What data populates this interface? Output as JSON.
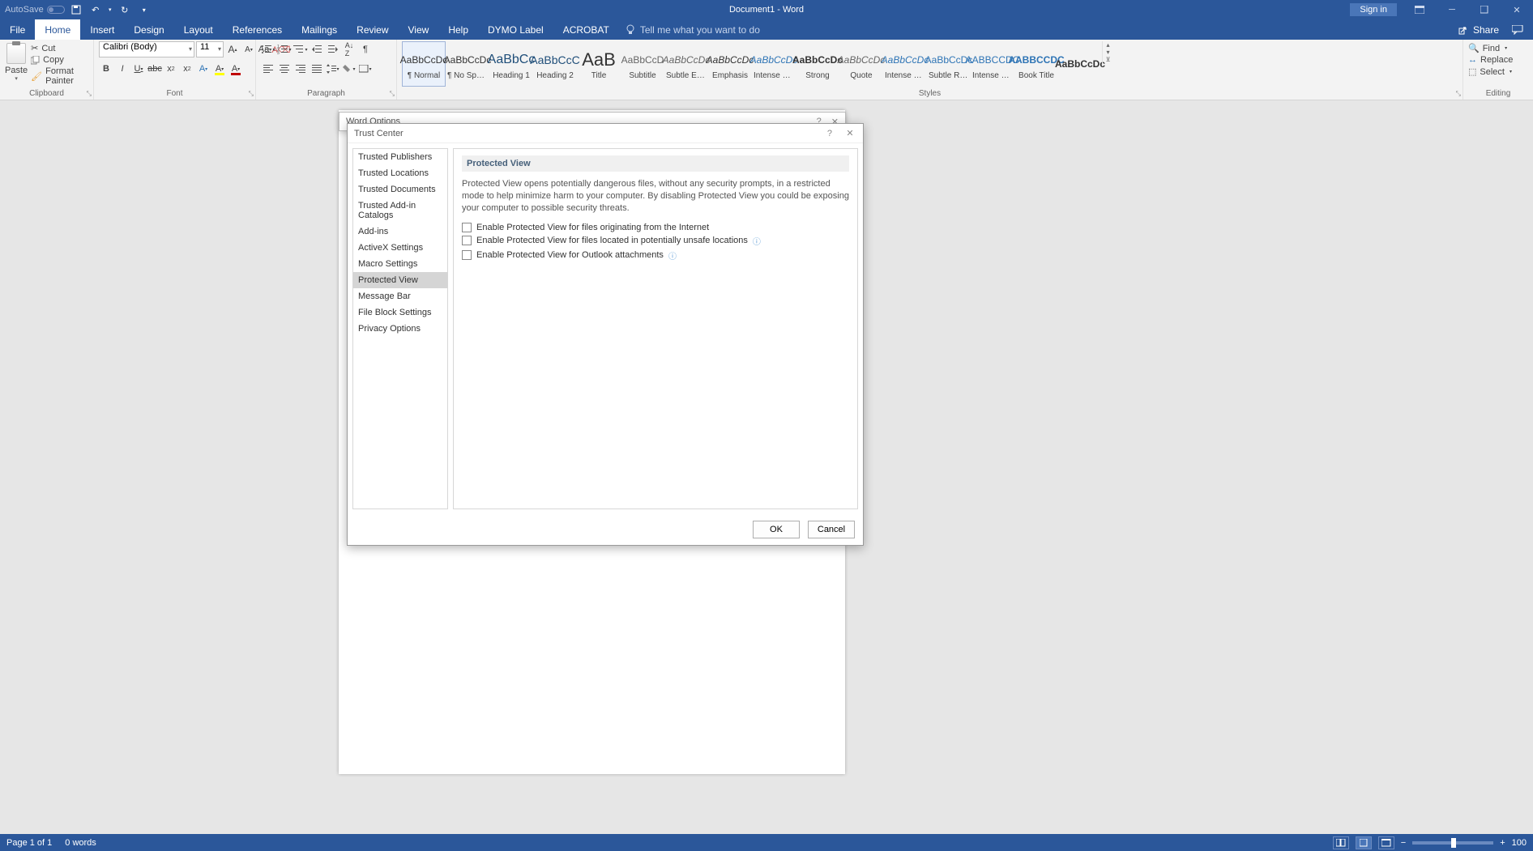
{
  "titlebar": {
    "autosave": "AutoSave",
    "title": "Document1  -  Word",
    "signin": "Sign in"
  },
  "tabs": {
    "items": [
      "File",
      "Home",
      "Insert",
      "Design",
      "Layout",
      "References",
      "Mailings",
      "Review",
      "View",
      "Help",
      "DYMO Label",
      "ACROBAT"
    ],
    "active": "Home",
    "tellme_placeholder": "Tell me what you want to do",
    "share": "Share"
  },
  "ribbon": {
    "clipboard": {
      "label": "Clipboard",
      "paste": "Paste",
      "cut": "Cut",
      "copy": "Copy",
      "format_painter": "Format Painter"
    },
    "font": {
      "label": "Font",
      "name": "Calibri (Body)",
      "size": "11"
    },
    "paragraph": {
      "label": "Paragraph"
    },
    "styles": {
      "label": "Styles",
      "items": [
        {
          "preview": "AaBbCcDc",
          "name": "¶ Normal",
          "bold": false,
          "color": "#333"
        },
        {
          "preview": "AaBbCcDc",
          "name": "¶ No Spac...",
          "bold": false,
          "color": "#333"
        },
        {
          "preview": "AaBbCc",
          "name": "Heading 1",
          "bold": false,
          "color": "#1f4e79",
          "size": "16px"
        },
        {
          "preview": "AaBbCcC",
          "name": "Heading 2",
          "bold": false,
          "color": "#1f4e79",
          "size": "14px"
        },
        {
          "preview": "AaB",
          "name": "Title",
          "bold": false,
          "color": "#333",
          "size": "22px"
        },
        {
          "preview": "AaBbCcD",
          "name": "Subtitle",
          "bold": false,
          "color": "#666"
        },
        {
          "preview": "AaBbCcDc",
          "name": "Subtle Em...",
          "bold": false,
          "color": "#666",
          "italic": true
        },
        {
          "preview": "AaBbCcDc",
          "name": "Emphasis",
          "bold": false,
          "color": "#333",
          "italic": true
        },
        {
          "preview": "AaBbCcDc",
          "name": "Intense E...",
          "bold": false,
          "color": "#2e74b5",
          "italic": true
        },
        {
          "preview": "AaBbCcDc",
          "name": "Strong",
          "bold": true,
          "color": "#333"
        },
        {
          "preview": "AaBbCcDc",
          "name": "Quote",
          "bold": false,
          "color": "#666",
          "italic": true
        },
        {
          "preview": "AaBbCcDc",
          "name": "Intense Q...",
          "bold": false,
          "color": "#2e74b5",
          "italic": true
        },
        {
          "preview": "AaBbCcDc",
          "name": "Subtle Ref...",
          "bold": false,
          "color": "#2e74b5"
        },
        {
          "preview": "AABBCCDC",
          "name": "Intense Re...",
          "bold": false,
          "color": "#2e74b5"
        },
        {
          "preview": "AABBCCDC",
          "name": "Book Title",
          "bold": true,
          "color": "#2e74b5"
        },
        {
          "preview": "AaBbCcDc",
          "name": "",
          "bold": true,
          "color": "#333"
        }
      ]
    },
    "editing": {
      "label": "Editing",
      "find": "Find",
      "replace": "Replace",
      "select": "Select"
    }
  },
  "back_dialog": {
    "title": "Word Options"
  },
  "dialog": {
    "title": "Trust Center",
    "nav": [
      "Trusted Publishers",
      "Trusted Locations",
      "Trusted Documents",
      "Trusted Add-in Catalogs",
      "Add-ins",
      "ActiveX Settings",
      "Macro Settings",
      "Protected View",
      "Message Bar",
      "File Block Settings",
      "Privacy Options"
    ],
    "nav_selected": "Protected View",
    "section_header": "Protected View",
    "description": "Protected View opens potentially dangerous files, without any security prompts, in a restricted mode to help minimize harm to your computer. By disabling Protected View you could be exposing your computer to possible security threats.",
    "checks": [
      "Enable Protected View for files originating from the Internet",
      "Enable Protected View for files located in potentially unsafe locations",
      "Enable Protected View for Outlook attachments"
    ],
    "ok": "OK",
    "cancel": "Cancel"
  },
  "statusbar": {
    "page": "Page 1 of 1",
    "words": "0 words",
    "zoom": "100"
  }
}
